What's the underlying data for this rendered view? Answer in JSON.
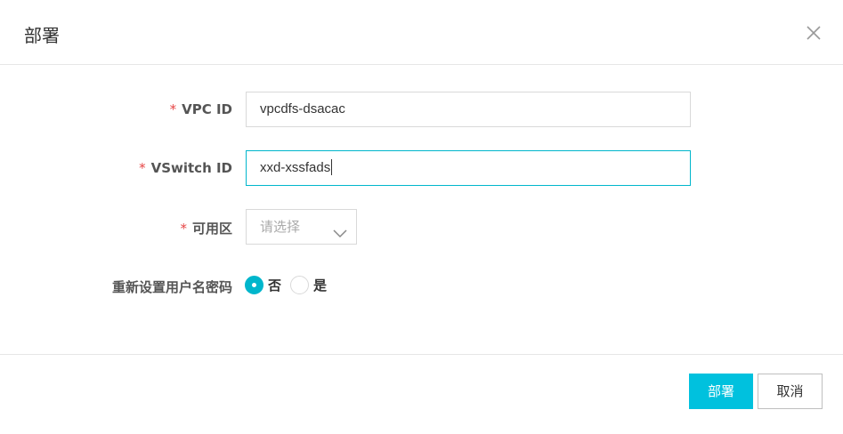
{
  "dialog": {
    "title": "部署",
    "close_icon": "close-icon"
  },
  "form": {
    "required_mark": "*",
    "vpc": {
      "label": "VPC ID",
      "value": "vpcdfs-dsacac"
    },
    "vswitch": {
      "label": "VSwitch ID",
      "value": "xxd-xssfads"
    },
    "zone": {
      "label": "可用区",
      "placeholder": "请选择",
      "icon": "chevron-down-icon"
    },
    "reset_credentials": {
      "label": "重新设置用户名密码",
      "options": [
        {
          "label": "否",
          "checked": true
        },
        {
          "label": "是",
          "checked": false
        }
      ]
    }
  },
  "footer": {
    "confirm_label": "部署",
    "cancel_label": "取消"
  },
  "colors": {
    "accent": "#00c1de",
    "focus_border": "#00b6cc",
    "required": "#e64545"
  }
}
